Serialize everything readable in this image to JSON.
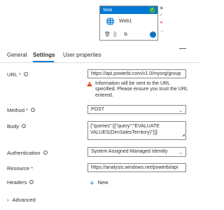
{
  "activity": {
    "type_label": "Web",
    "name": "Web1",
    "status_glyph": "✓",
    "actions": [
      "🗑",
      "{}",
      "⧉"
    ],
    "run_glyph": "➔",
    "side_indicators": [
      "◉",
      "✓",
      "✕",
      "→"
    ]
  },
  "tabs": [
    {
      "label": "General"
    },
    {
      "label": "Settings"
    },
    {
      "label": "User properties"
    }
  ],
  "form": {
    "url": {
      "label": "URL",
      "required_mark": "*",
      "value": "https://api.powerbi.com/v1.0/myorg/group",
      "warning": "Information will be sent to the URL specified. Please ensure you trust the URL entered."
    },
    "method": {
      "label": "Method",
      "required_mark": "*",
      "value": "POST"
    },
    "body": {
      "label": "Body",
      "value": "{\"queries\":[{\"query\":\"EVALUATE VALUES(DimSalesTerritory)\"}]}"
    },
    "authentication": {
      "label": "Authentication",
      "value": "System Assigned Managed Identity"
    },
    "resource": {
      "label": "Resource",
      "required_mark": "*",
      "value": "https://analysis.windows.net/powerbi/api"
    },
    "headers": {
      "label": "Headers",
      "add_label": "New"
    },
    "advanced_label": "Advanced"
  },
  "colors": {
    "accent": "#0078d4",
    "success": "#3aa84e",
    "warning": "#d83b01",
    "required": "#a4262c"
  }
}
